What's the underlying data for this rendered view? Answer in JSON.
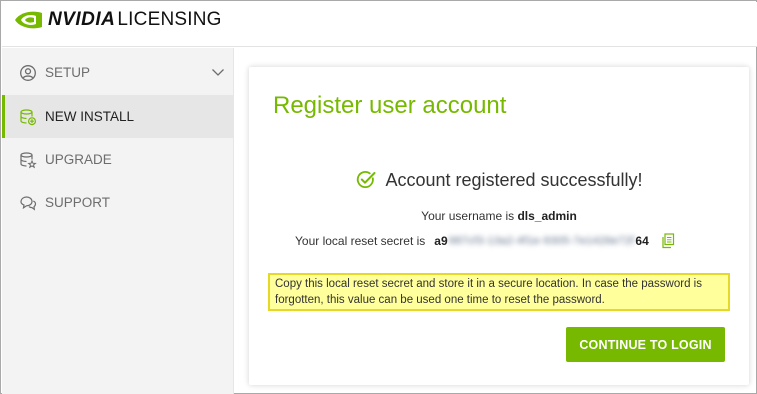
{
  "header": {
    "brand_bold": "NVIDIA",
    "brand_light": "LICENSING",
    "brand_color": "#76b900"
  },
  "sidebar": {
    "items": [
      {
        "label": "SETUP",
        "icon": "user-circle-icon",
        "expandable": true
      },
      {
        "label": "NEW INSTALL",
        "icon": "database-add-icon",
        "active": true
      },
      {
        "label": "UPGRADE",
        "icon": "database-star-icon"
      },
      {
        "label": "SUPPORT",
        "icon": "chat-bubbles-icon"
      }
    ]
  },
  "card": {
    "title": "Register user account",
    "success_message": "Account registered successfully!",
    "username_prefix": "Your username is",
    "username": "dls_admin",
    "secret_prefix": "Your local reset secret is",
    "secret_start": "a9",
    "secret_masked": "987cf3-13a2-4f1e-9305-7e1426e72f",
    "secret_end": "64",
    "notice": "Copy this local reset secret and store it in a secure location. In case the password is forgotten, this value can be used one time to reset the password.",
    "continue_label": "CONTINUE TO LOGIN"
  },
  "colors": {
    "accent": "#76b900",
    "notice_bg": "#ffff9c",
    "notice_border": "#e5d828"
  }
}
